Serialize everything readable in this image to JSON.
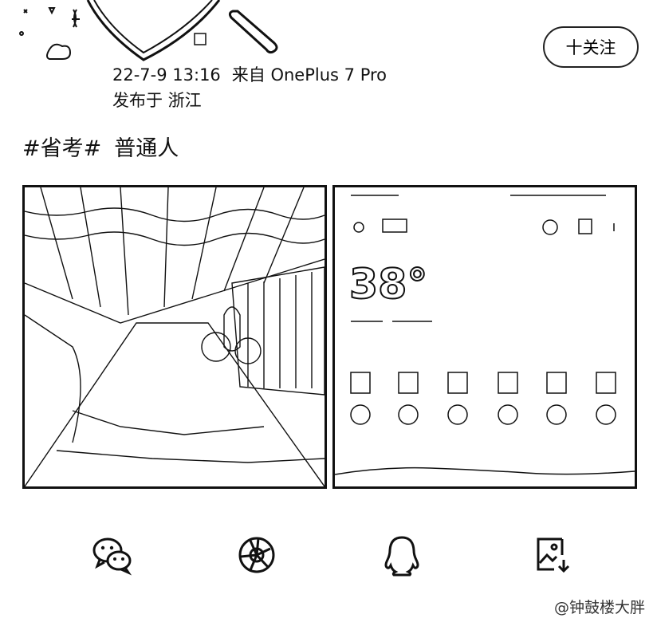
{
  "post": {
    "time": "22-7-9 13:16",
    "source": "来自 OnePlus 7 Pro",
    "location": "发布于 浙江",
    "hashtag": "#省考#",
    "text": "普通人"
  },
  "follow_button": {
    "label": "十关注"
  },
  "photos": {
    "weather_temp": "38°"
  },
  "share": {
    "items": [
      "wechat-icon",
      "moments-icon",
      "qq-icon",
      "save-image-icon"
    ]
  },
  "watermark": "@钟鼓楼大胖"
}
